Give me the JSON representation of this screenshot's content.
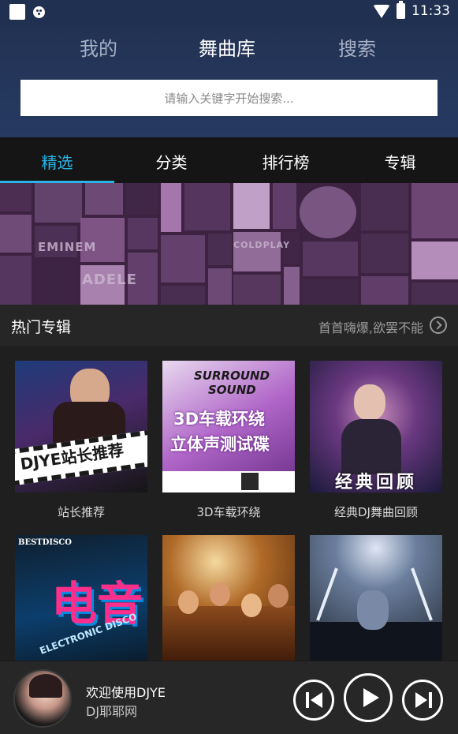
{
  "status_bar": {
    "time": "11:33"
  },
  "top_tabs": [
    {
      "label": "我的",
      "active": false
    },
    {
      "label": "舞曲库",
      "active": true
    },
    {
      "label": "搜索",
      "active": false
    }
  ],
  "search": {
    "placeholder": "请输入关键字开始搜索..."
  },
  "sub_tabs": [
    {
      "label": "精选",
      "active": true
    },
    {
      "label": "分类",
      "active": false
    },
    {
      "label": "排行榜",
      "active": false
    },
    {
      "label": "专辑",
      "active": false
    }
  ],
  "banner": {
    "artist_labels": [
      "EMINEM",
      "ADELE",
      "COLDPLAY"
    ]
  },
  "hot_albums": {
    "title": "热门专辑",
    "more_text": "首首嗨爆,欲罢不能",
    "items": [
      {
        "label": "站长推荐",
        "cover_text": "DJYE站长推荐"
      },
      {
        "label": "3D车载环绕",
        "cover_text": [
          "SURROUND",
          "SOUND",
          "3D车载环绕",
          "立体声测试碟"
        ]
      },
      {
        "label": "经典DJ舞曲回顾",
        "cover_text": "经典回顾"
      },
      {
        "label": "",
        "cover_text": [
          "BESTDISCO",
          "电音",
          "ELECTRONIC DISCO"
        ]
      },
      {
        "label": "",
        "cover_text": ""
      },
      {
        "label": "",
        "cover_text": ""
      }
    ]
  },
  "player": {
    "title": "欢迎使用DJYE",
    "subtitle": "DJ耶耶网"
  },
  "colors": {
    "accent": "#29b6e6",
    "header": "#223253"
  }
}
